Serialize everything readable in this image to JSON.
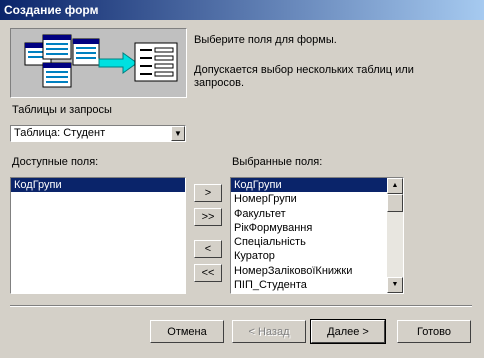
{
  "window": {
    "title": "Создание форм"
  },
  "intro": {
    "line1": "Выберите поля для формы.",
    "line2": "Допускается выбор нескольких таблиц или запросов."
  },
  "tables": {
    "label": "Таблицы и запросы",
    "selected": "Таблица: Студент"
  },
  "available": {
    "label": "Доступные поля:",
    "items": [
      "КодГрупи"
    ],
    "selected_index": 0
  },
  "chosen": {
    "label": "Выбранные поля:",
    "items": [
      "КодГрупи",
      "НомерГрупи",
      "Факультет",
      "РікФормування",
      "Спеціальність",
      "Куратор",
      "НомерЗаліковоїКнижки",
      "ПІП_Студента"
    ],
    "selected_index": 0
  },
  "move_buttons": {
    "add_one": ">",
    "add_all": ">>",
    "remove_one": "<",
    "remove_all": "<<"
  },
  "footer": {
    "cancel": "Отмена",
    "back": "< Назад",
    "next": "Далее >",
    "finish": "Готово"
  },
  "colors": {
    "selection": "#0a246a",
    "face": "#d4d0c8",
    "title_start": "#0a246a",
    "title_end": "#a6caf0"
  }
}
